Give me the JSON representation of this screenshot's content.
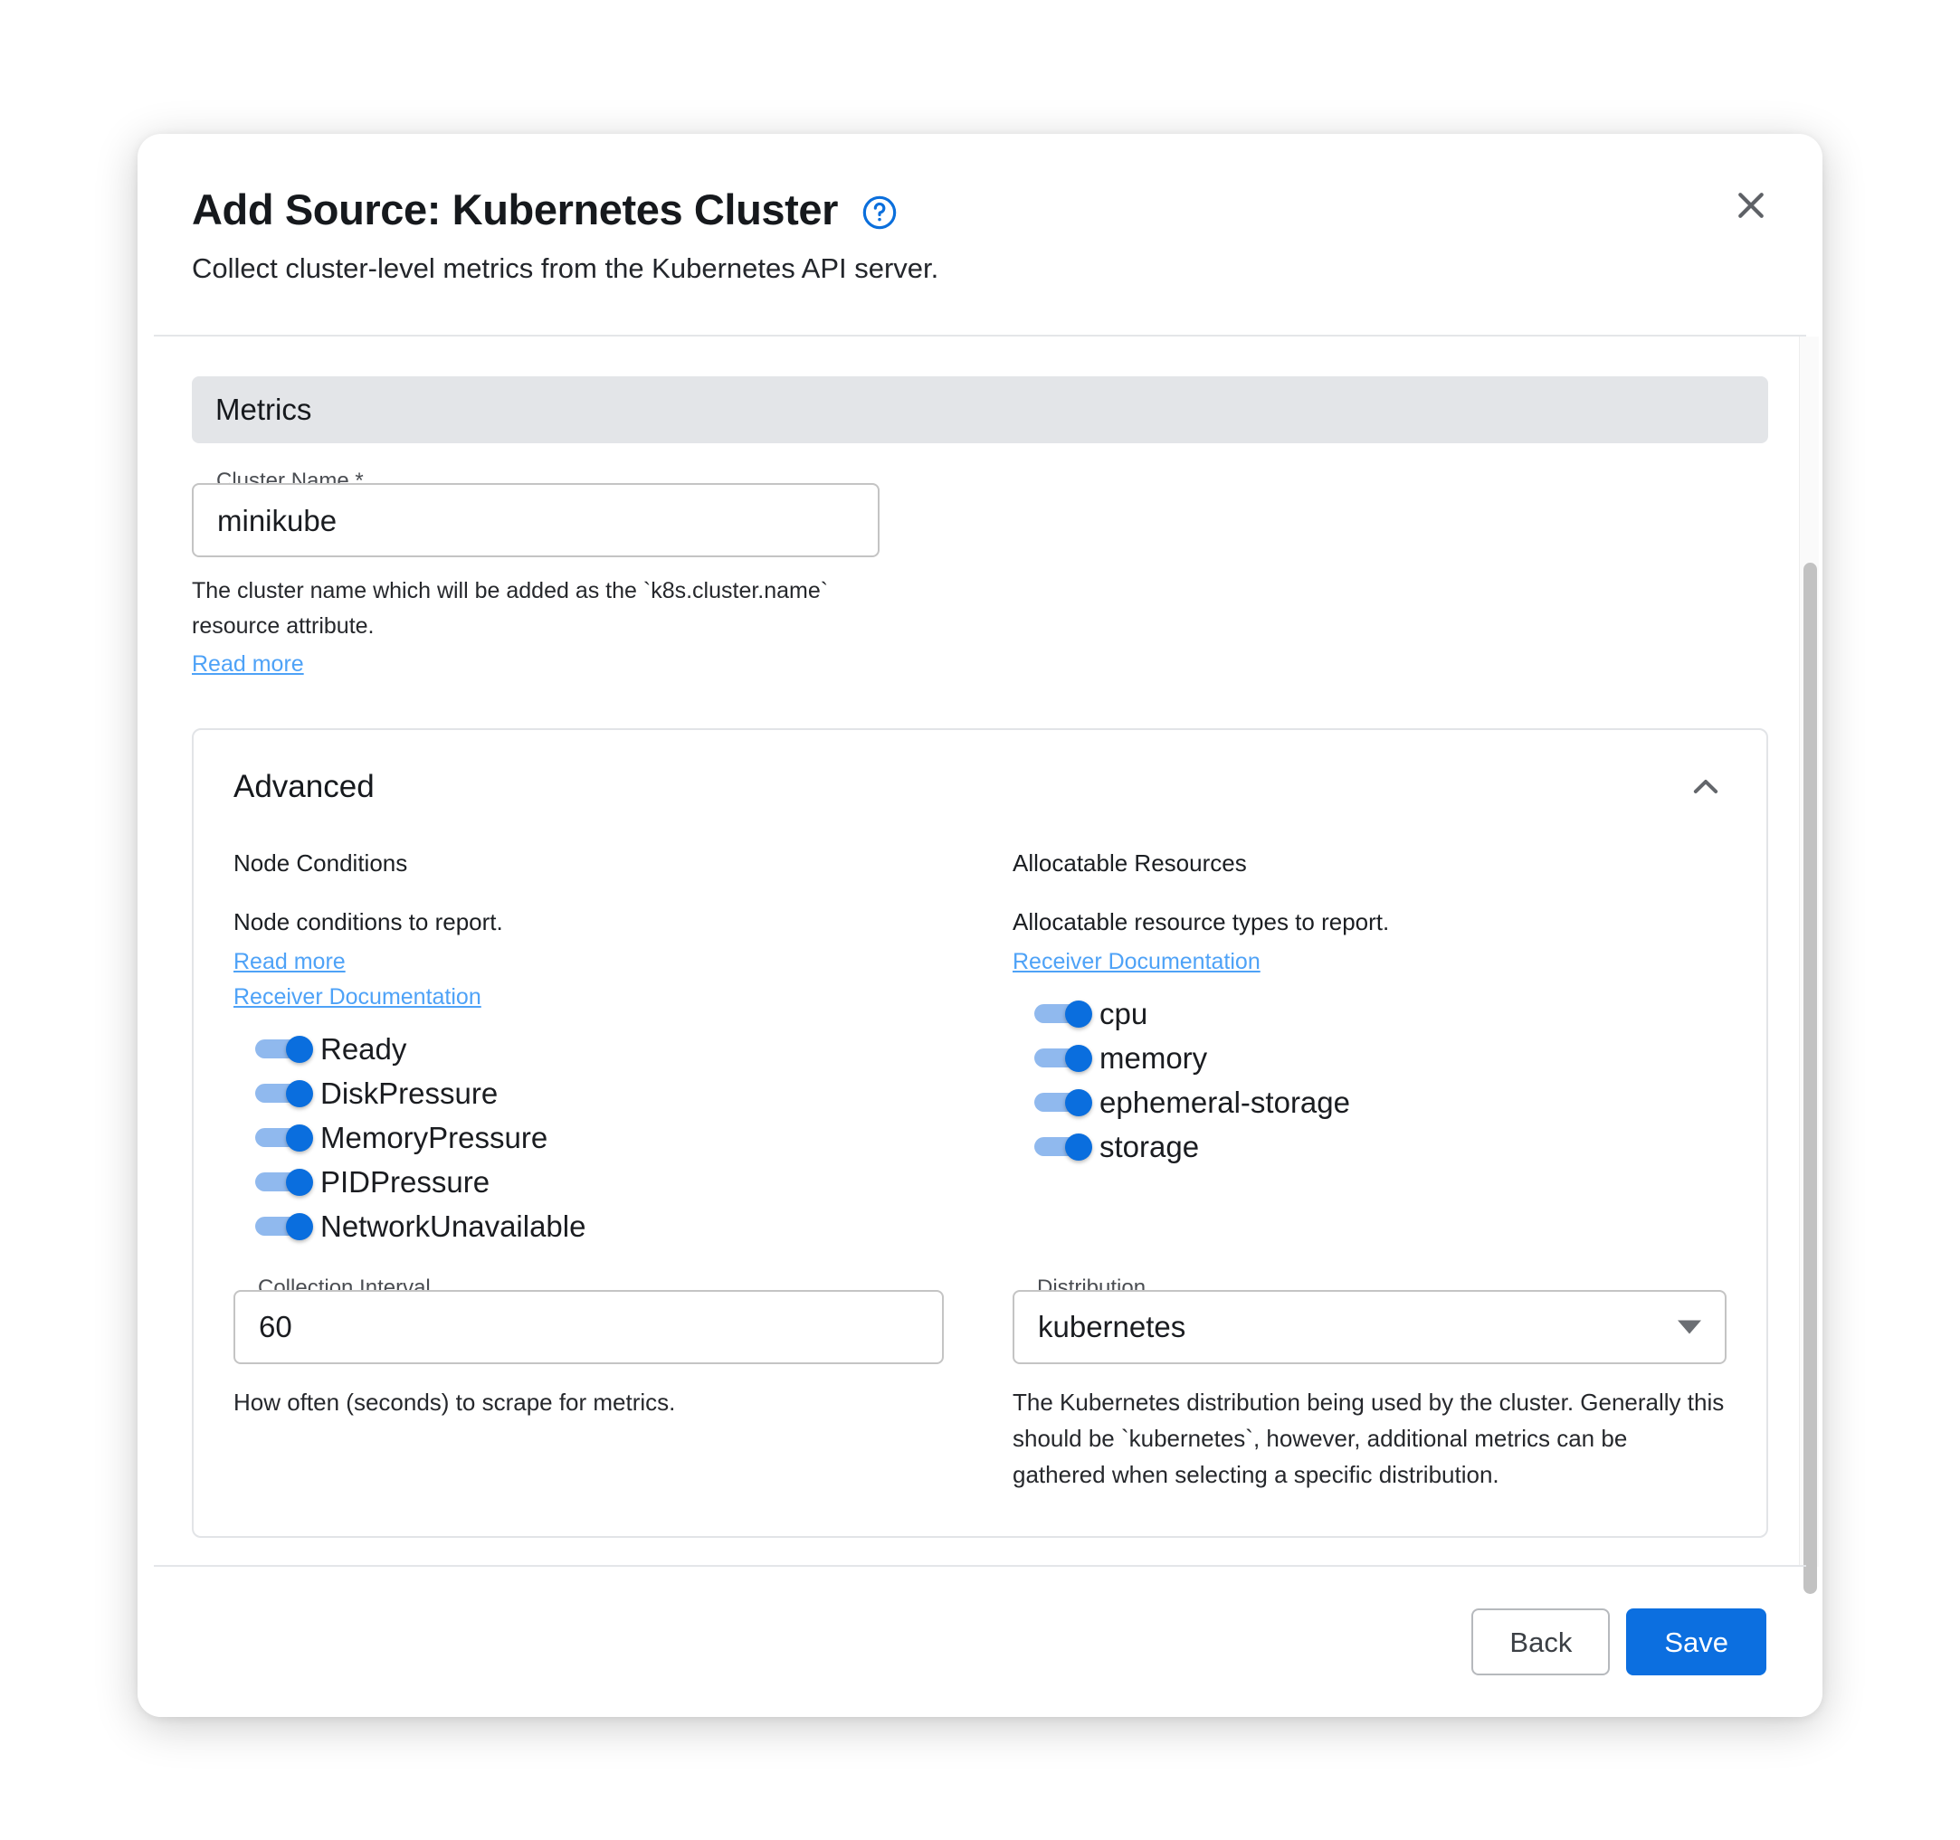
{
  "modal": {
    "title": "Add Source: Kubernetes Cluster",
    "subtitle": "Collect cluster-level metrics from the Kubernetes API server.",
    "help_icon": "help-circle-icon",
    "close_icon": "close-icon"
  },
  "section": {
    "label": "Metrics"
  },
  "cluster_name": {
    "legend": "Cluster Name",
    "required_marker": "*",
    "value": "minikube",
    "help": "The cluster name which will be added as the `k8s.cluster.name` resource attribute.",
    "read_more": "Read more"
  },
  "advanced": {
    "title": "Advanced",
    "collapse_icon": "chevron-up-icon",
    "node_conditions": {
      "title": "Node Conditions",
      "description": "Node conditions to report.",
      "read_more": "Read more",
      "receiver_docs": "Receiver Documentation",
      "toggles": [
        {
          "label": "Ready",
          "on": true
        },
        {
          "label": "DiskPressure",
          "on": true
        },
        {
          "label": "MemoryPressure",
          "on": true
        },
        {
          "label": "PIDPressure",
          "on": true
        },
        {
          "label": "NetworkUnavailable",
          "on": true
        }
      ]
    },
    "allocatable_resources": {
      "title": "Allocatable Resources",
      "description": "Allocatable resource types to report.",
      "receiver_docs": "Receiver Documentation",
      "toggles": [
        {
          "label": "cpu",
          "on": true
        },
        {
          "label": "memory",
          "on": true
        },
        {
          "label": "ephemeral-storage",
          "on": true
        },
        {
          "label": "storage",
          "on": true
        }
      ]
    },
    "collection_interval": {
      "legend": "Collection Interval",
      "value": "60",
      "help": "How often (seconds) to scrape for metrics."
    },
    "distribution": {
      "legend": "Distribution",
      "value": "kubernetes",
      "dropdown_icon": "chevron-down-icon",
      "help": "The Kubernetes distribution being used by the cluster. Generally this should be `kubernetes`, however, additional metrics can be gathered when selecting a specific distribution."
    }
  },
  "footer": {
    "back_label": "Back",
    "save_label": "Save"
  },
  "colors": {
    "accent_blue": "#0c6fe0",
    "link_blue": "#4ea2f7",
    "section_bar": "#e3e5e8",
    "toggle_track": "#90b9ee",
    "toggle_thumb": "#0a6ede"
  }
}
